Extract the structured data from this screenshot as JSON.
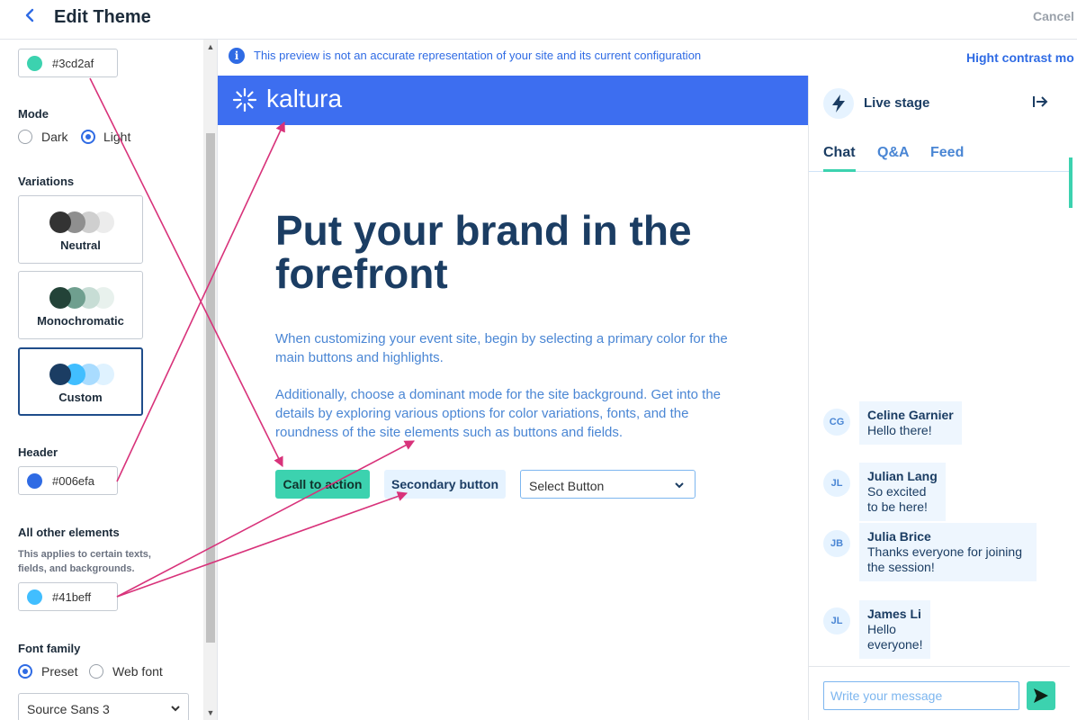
{
  "header": {
    "back_icon": "chevron-left-icon",
    "title": "Edit Theme",
    "cancel_label": "Cancel"
  },
  "left_panel": {
    "primary_color": {
      "value": "#3cd2af"
    },
    "mode": {
      "label": "Mode",
      "options": [
        "Dark",
        "Light"
      ],
      "selected": "Light"
    },
    "variations": {
      "label": "Variations",
      "cards": [
        {
          "name": "Neutral",
          "colors": [
            "#333333",
            "#8f8f8f",
            "#cfcfcf",
            "#ececec"
          ]
        },
        {
          "name": "Monochromatic",
          "colors": [
            "#234338",
            "#6f9f8f",
            "#c7ddd5",
            "#e8f1ed"
          ]
        },
        {
          "name": "Custom",
          "colors": [
            "#1b3d63",
            "#41beff",
            "#a9dcff",
            "#dff2ff"
          ]
        }
      ],
      "selected": "Custom"
    },
    "header_color": {
      "label": "Header",
      "value": "#006efa"
    },
    "other_elements": {
      "label": "All other elements",
      "description": "This applies to certain texts, fields, and backgrounds.",
      "value": "#41beff"
    },
    "font_family": {
      "label": "Font family",
      "options": [
        "Preset",
        "Web font"
      ],
      "selected": "Preset",
      "select_value": "Source Sans 3"
    }
  },
  "info_banner": {
    "text": "This preview is not an accurate representation of your site and its current configuration",
    "contrast_label": "Hight contrast mo"
  },
  "preview": {
    "brand": "kaltura",
    "header_bg": "#3d6ef0",
    "hero_title": "Put your brand in the forefront",
    "paragraph_1": "When customizing your event site, begin by selecting a primary color for the main buttons and highlights.",
    "paragraph_2": "Additionally, choose a dominant mode for the site background. Get into the details by exploring various options for color variations, fonts, and the roundness of the site elements such as buttons and fields.",
    "cta_label": "Call to action",
    "secondary_label": "Secondary button",
    "select_label": "Select Button"
  },
  "live_panel": {
    "title": "Live stage",
    "tabs": [
      "Chat",
      "Q&A",
      "Feed"
    ],
    "active_tab": "Chat",
    "messages": [
      {
        "initials": "CG",
        "name": "Celine Garnier",
        "text": "Hello there!"
      },
      {
        "initials": "JL",
        "name": "Julian Lang",
        "text": "So excited to be here!"
      },
      {
        "initials": "JB",
        "name": "Julia Brice",
        "text": "Thanks everyone for joining the session!"
      },
      {
        "initials": "JL",
        "name": "James Li",
        "text": "Hello everyone!"
      }
    ],
    "composer_placeholder": "Write your message"
  },
  "colors": {
    "accent_blue": "#2f6be4",
    "annotation_arrow": "#d8327a"
  }
}
